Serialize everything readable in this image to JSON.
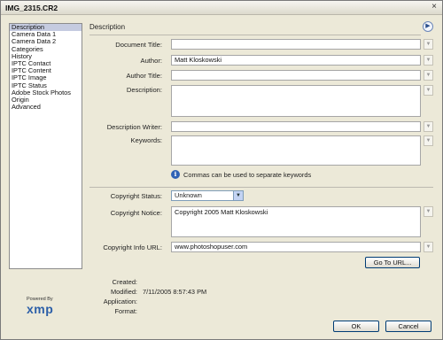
{
  "window": {
    "title": "IMG_2315.CR2",
    "close_glyph": "×"
  },
  "sidebar": {
    "items": [
      {
        "label": "Description",
        "selected": true
      },
      {
        "label": "Camera Data 1"
      },
      {
        "label": "Camera Data 2"
      },
      {
        "label": "Categories"
      },
      {
        "label": "History"
      },
      {
        "label": "IPTC Contact"
      },
      {
        "label": "IPTC Content"
      },
      {
        "label": "IPTC Image"
      },
      {
        "label": "IPTC Status"
      },
      {
        "label": "Adobe Stock Photos"
      },
      {
        "label": "Origin"
      },
      {
        "label": "Advanced"
      }
    ]
  },
  "logo": {
    "powered_by": "Powered By",
    "wordmark": "xmp"
  },
  "section": {
    "title": "Description"
  },
  "form": {
    "document_title": {
      "label": "Document Title:",
      "value": ""
    },
    "author": {
      "label": "Author:",
      "value": "Matt Kloskowski"
    },
    "author_title": {
      "label": "Author Title:",
      "value": ""
    },
    "description": {
      "label": "Description:",
      "value": ""
    },
    "description_writer": {
      "label": "Description Writer:",
      "value": ""
    },
    "keywords": {
      "label": "Keywords:",
      "value": ""
    },
    "keywords_hint": "Commas can be used to separate keywords",
    "copyright_status": {
      "label": "Copyright Status:",
      "value": "Unknown"
    },
    "copyright_notice": {
      "label": "Copyright Notice:",
      "value": "Copyright 2005 Matt Kloskowski"
    },
    "copyright_url": {
      "label": "Copyright Info URL:",
      "value": "www.photoshopuser.com"
    },
    "goto_url_label": "Go To URL..."
  },
  "metadata": {
    "created": {
      "label": "Created:",
      "value": ""
    },
    "modified": {
      "label": "Modified:",
      "value": "7/11/2005 8:57:43 PM"
    },
    "application": {
      "label": "Application:",
      "value": ""
    },
    "format": {
      "label": "Format:",
      "value": ""
    }
  },
  "footer": {
    "ok_label": "OK",
    "cancel_label": "Cancel"
  }
}
